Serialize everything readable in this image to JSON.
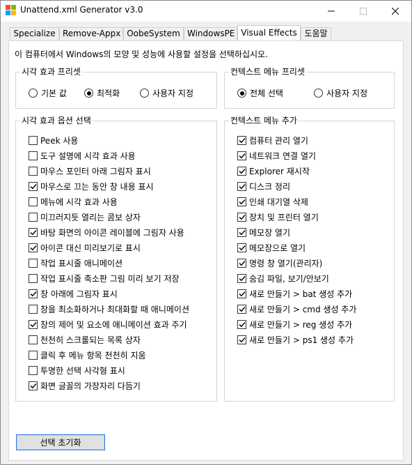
{
  "window": {
    "title": "Unattend.xml Generator v3.0",
    "icon_colors": [
      "#f25022",
      "#7fba00",
      "#00a4ef",
      "#ffb900"
    ]
  },
  "tabs": [
    {
      "label": "Specialize",
      "active": false
    },
    {
      "label": "Remove-Appx",
      "active": false
    },
    {
      "label": "OobeSystem",
      "active": false
    },
    {
      "label": "WindowsPE",
      "active": false
    },
    {
      "label": "Visual Effects",
      "active": true
    },
    {
      "label": "도움말",
      "active": false
    }
  ],
  "intro": "이 컴퓨터에서 Windows의 모양 및 성능에 사용할 설정을 선택하십시오.",
  "visual_preset": {
    "title": "시각 효과 프리셋",
    "options": [
      {
        "label": "기본 값",
        "selected": false
      },
      {
        "label": "최적화",
        "selected": true
      },
      {
        "label": "사용자 지정",
        "selected": false
      }
    ]
  },
  "context_preset": {
    "title": "컨텍스트 메뉴 프리셋",
    "options": [
      {
        "label": "전체 선택",
        "selected": true
      },
      {
        "label": "사용자 지정",
        "selected": false
      }
    ]
  },
  "visual_options": {
    "title": "시각 효과 옵션 선택",
    "items": [
      {
        "label": "Peek 사용",
        "checked": false
      },
      {
        "label": "도구 설명에 시각 효과 사용",
        "checked": false
      },
      {
        "label": "마우스 포인터 아래 그림자 표시",
        "checked": false
      },
      {
        "label": "마우스로 끄는 동안 창 내용 표시",
        "checked": true
      },
      {
        "label": "메뉴에 시각 효과 사용",
        "checked": false
      },
      {
        "label": "미끄러지듯 열리는 콤보 상자",
        "checked": false
      },
      {
        "label": "바탕 화면의 아이콘 레이블에 그림자 사용",
        "checked": true
      },
      {
        "label": "아이콘 대신 미리보기로 표시",
        "checked": true
      },
      {
        "label": "작업 표시줄 애니메이션",
        "checked": false
      },
      {
        "label": "작업 표시줄 축소판 그림 미리 보기 저장",
        "checked": false
      },
      {
        "label": "창 아래에 그림자 표시",
        "checked": true
      },
      {
        "label": "창을 최소화하거나 최대화할 때 애니메이션",
        "checked": false
      },
      {
        "label": "창의 제어 및 요소에 애니메이션 효과 주기",
        "checked": true
      },
      {
        "label": "천천히 스크롤되는 목록 상자",
        "checked": false
      },
      {
        "label": "클릭 후 메뉴 항목 천천히 지움",
        "checked": false
      },
      {
        "label": "투명한 선택 사각형 표시",
        "checked": false
      },
      {
        "label": "화면 글꼴의 가장자리 다듬기",
        "checked": true
      }
    ]
  },
  "context_add": {
    "title": "컨텍스트 메뉴 추가",
    "items": [
      {
        "label": "컴퓨터 관리 열기",
        "checked": true
      },
      {
        "label": "네트워크 연결 열기",
        "checked": true
      },
      {
        "label": "Explorer 재시작",
        "checked": true
      },
      {
        "label": "디스크 정리",
        "checked": true
      },
      {
        "label": "인쇄 대기열 삭제",
        "checked": true
      },
      {
        "label": "장치 및 프린터 열기",
        "checked": true
      },
      {
        "label": "메모장 열기",
        "checked": true
      },
      {
        "label": "메모장으로 열기",
        "checked": true
      },
      {
        "label": "명령 창 열기(관리자)",
        "checked": true
      },
      {
        "label": "숨김 파일, 보기/안보기",
        "checked": true
      },
      {
        "label": "새로 만들기 > bat 생성 추가",
        "checked": true
      },
      {
        "label": "새로 만들기 > cmd 생성 추가",
        "checked": true
      },
      {
        "label": "새로 만들기 > reg 생성 추가",
        "checked": true
      },
      {
        "label": "새로 만들기 > ps1 생성 추가",
        "checked": true
      }
    ]
  },
  "reset_button": "선택 초기화"
}
